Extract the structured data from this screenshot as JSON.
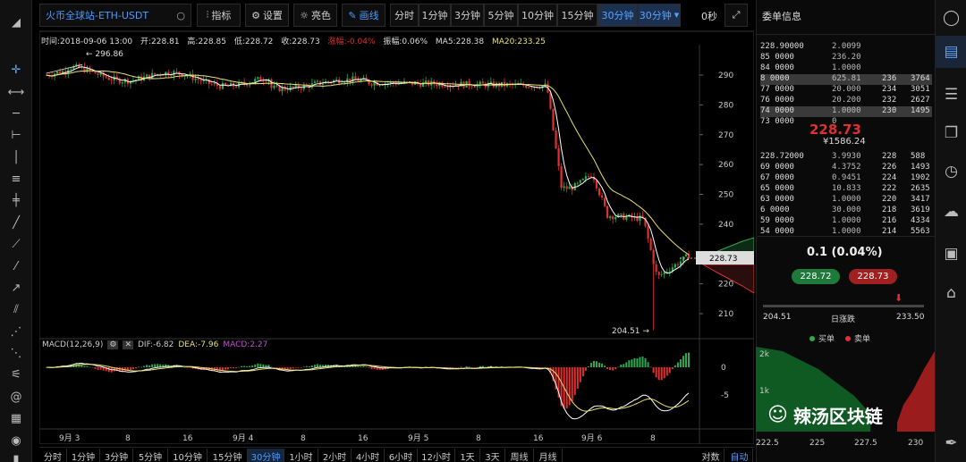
{
  "toolbar": {
    "market": "火币全球站-ETH-USDT",
    "indicators_label": "指标",
    "settings_label": "设置",
    "theme_label": "亮色",
    "draw_label": "画线",
    "intervals": [
      "分时",
      "1分钟",
      "3分钟",
      "5分钟",
      "10分钟",
      "15分钟",
      "30分钟"
    ],
    "interval_dropdown": "30分钟",
    "countdown": "0秒"
  },
  "ohlc": {
    "time": "时间:2018-09-06 13:00",
    "open": "开:228.81",
    "high": "高:228.85",
    "low": "低:228.72",
    "close": "收:228.73",
    "change": "涨幅:-0.04%",
    "amplitude": "振幅:0.06%",
    "ma5": "MA5:228.38",
    "ma20": "MA20:233.25"
  },
  "macd": {
    "label": "MACD(12,26,9)",
    "dif": "DIF:-6.82",
    "dea": "DEA:-7.96",
    "macd": "MACD:2.27"
  },
  "chart_data": {
    "type": "candlestick",
    "price_axis": [
      "290",
      "280",
      "270",
      "260",
      "250",
      "240",
      "230",
      "220",
      "210"
    ],
    "macd_axis": [
      "0",
      "-5"
    ],
    "x_labels": [
      "9月 3",
      "8",
      "16",
      "9月 4",
      "8",
      "16",
      "9月 5",
      "8",
      "16",
      "9月 6",
      "8"
    ],
    "current_price": "228.73",
    "max_label": "296.86",
    "min_label": "204.51 →",
    "depth_axis": [
      "2k",
      "1k"
    ],
    "depth_x": [
      "222.5",
      "225",
      "227.5",
      "230"
    ]
  },
  "bottombar": {
    "intervals": [
      "分时",
      "1分钟",
      "3分钟",
      "5分钟",
      "10分钟",
      "15分钟",
      "30分钟",
      "1小时",
      "2小时",
      "4小时",
      "6小时",
      "12小时",
      "1天",
      "3天",
      "周线",
      "月线"
    ],
    "log_label": "对数",
    "auto_label": "自动"
  },
  "orderbook": {
    "title": "委单信息",
    "asks": [
      [
        "228.90000",
        "2.0099",
        "",
        ""
      ],
      [
        "85 0000",
        "236.20",
        "",
        ""
      ],
      [
        "84 0000",
        "1.0000",
        "",
        ""
      ],
      [
        "8 0000",
        "625.81",
        "236",
        "3764"
      ],
      [
        "77 0000",
        "20.000",
        "234",
        "3051"
      ],
      [
        "76 0000",
        "20.200",
        "232",
        "2627"
      ],
      [
        "74 0000",
        "1.0000",
        "230",
        "1495"
      ],
      [
        "73 0000",
        "0",
        "",
        ""
      ]
    ],
    "last_price": "228.73",
    "cny_price": "¥1586.24",
    "bids": [
      [
        "228.72000",
        "3.9930",
        "228",
        "588"
      ],
      [
        "69 0000",
        "4.3752",
        "226",
        "1493"
      ],
      [
        "67 0000",
        "0.9451",
        "224",
        "1902"
      ],
      [
        "65 0000",
        "10.833",
        "222",
        "2635"
      ],
      [
        "63 0000",
        "1.0000",
        "220",
        "3417"
      ],
      [
        "6 0000",
        "30.000",
        "218",
        "3619"
      ],
      [
        "59 0000",
        "1.0000",
        "216",
        "4334"
      ],
      [
        "54 0000",
        "1.0000",
        "214",
        "5563"
      ]
    ],
    "spread": "0.1 (0.04%)",
    "bid_button": "228.72",
    "ask_button": "228.73",
    "day_low": "204.51",
    "day_label": "日涨跌",
    "day_high": "233.50",
    "legend_buy": "买单",
    "legend_sell": "卖单"
  },
  "watermark": "辣汤区块链",
  "colors": {
    "up": "#2fa84f",
    "down": "#e0302f",
    "accent": "#4a9cff",
    "ma5": "#ffffff",
    "ma20": "#e8e070"
  }
}
